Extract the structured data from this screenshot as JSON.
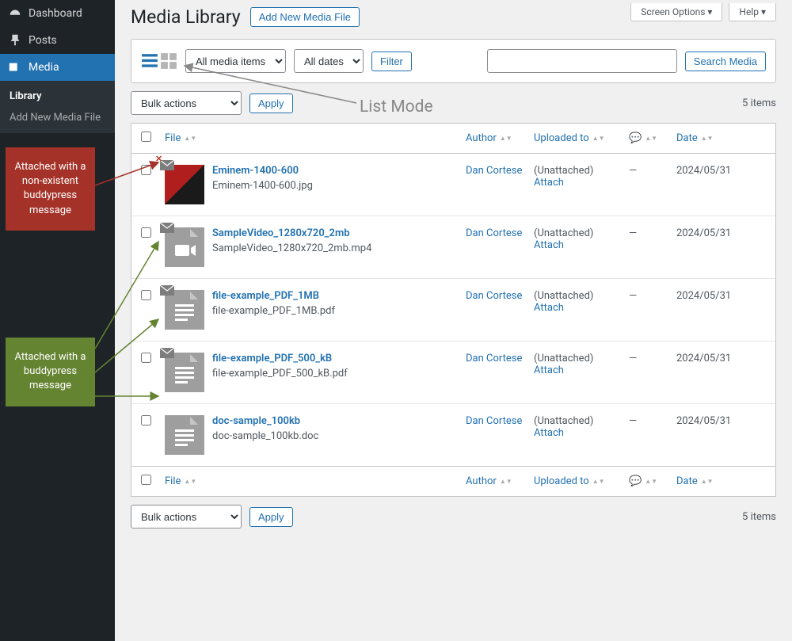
{
  "topbar": {
    "screen_options": "Screen Options ▾",
    "help": "Help ▾"
  },
  "page": {
    "title": "Media Library",
    "add_new": "Add New Media File"
  },
  "sidebar": {
    "items": [
      {
        "label": "Dashboard"
      },
      {
        "label": "Posts"
      },
      {
        "label": "Media"
      }
    ],
    "sub": [
      {
        "label": "Library",
        "current": true
      },
      {
        "label": "Add New Media File"
      }
    ]
  },
  "callouts": {
    "red": "Attached with a non-existent buddypress message",
    "green": "Attached with a buddypress message"
  },
  "filters": {
    "type_options": [
      "All media items"
    ],
    "date_options": [
      "All dates"
    ],
    "filter_btn": "Filter",
    "search_btn": "Search Media"
  },
  "bulk": {
    "label": "Bulk actions",
    "apply": "Apply",
    "count": "5 items"
  },
  "columns": {
    "file": "File",
    "author": "Author",
    "parent": "Uploaded to",
    "comments": "💬",
    "date": "Date"
  },
  "annotations": {
    "list_mode": "List Mode"
  },
  "rows": [
    {
      "title": "Eminem-1400-600",
      "filename": "Eminem-1400-600.jpg",
      "author": "Dan Cortese",
      "parent_status": "(Unattached)",
      "parent_action": "Attach",
      "comments": "—",
      "date": "2024/05/31",
      "thumb": "eminem",
      "envelope": "bad"
    },
    {
      "title": "SampleVideo_1280x720_2mb",
      "filename": "SampleVideo_1280x720_2mb.mp4",
      "author": "Dan Cortese",
      "parent_status": "(Unattached)",
      "parent_action": "Attach",
      "comments": "—",
      "date": "2024/05/31",
      "thumb": "video",
      "envelope": "ok"
    },
    {
      "title": "file-example_PDF_1MB",
      "filename": "file-example_PDF_1MB.pdf",
      "author": "Dan Cortese",
      "parent_status": "(Unattached)",
      "parent_action": "Attach",
      "comments": "—",
      "date": "2024/05/31",
      "thumb": "doc",
      "envelope": "ok"
    },
    {
      "title": "file-example_PDF_500_kB",
      "filename": "file-example_PDF_500_kB.pdf",
      "author": "Dan Cortese",
      "parent_status": "(Unattached)",
      "parent_action": "Attach",
      "comments": "—",
      "date": "2024/05/31",
      "thumb": "doc",
      "envelope": "ok"
    },
    {
      "title": "doc-sample_100kb",
      "filename": "doc-sample_100kb.doc",
      "author": "Dan Cortese",
      "parent_status": "(Unattached)",
      "parent_action": "Attach",
      "comments": "—",
      "date": "2024/05/31",
      "thumb": "doc",
      "envelope": null
    }
  ]
}
